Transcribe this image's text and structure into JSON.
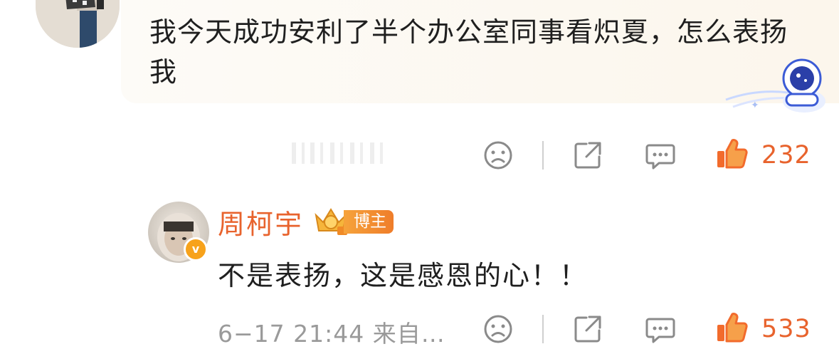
{
  "top_comment": {
    "text": "我今天成功安利了半个办公室同事看炽夏，怎么表扬我",
    "count": "232"
  },
  "reply": {
    "author": "周柯宇",
    "role_badge": "博主",
    "text": "不是表扬，这是感恩的心！！",
    "meta": "6−17 21:44 来自…",
    "count": "533"
  },
  "colors": {
    "accent": "#e8632d",
    "text": "#1f1f1f",
    "muted": "#9a9a9a",
    "icon": "#8a8a8a"
  },
  "icons": [
    "sad-face-icon",
    "share-icon",
    "comment-icon",
    "thumbs-up-icon",
    "crown-icon",
    "verified-icon",
    "astronaut-sticker"
  ]
}
